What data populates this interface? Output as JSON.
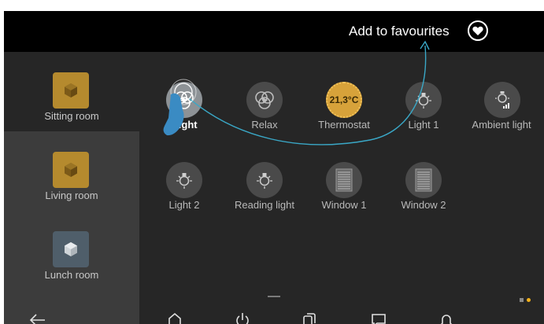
{
  "header": {
    "favourite_label": "Add to favourites",
    "favourite_icon": "heart-icon"
  },
  "sidebar": {
    "rooms": [
      {
        "label": "Sitting room",
        "color": "#b58a2e",
        "icon": "cube-icon"
      },
      {
        "label": "Living room",
        "color": "#b58a2e",
        "icon": "cube-icon",
        "selected": true
      },
      {
        "label": "Lunch room",
        "color": "#4f5e6a",
        "icon": "cube-icon"
      }
    ]
  },
  "tiles": [
    {
      "label": "Night",
      "icon": "scene-play-icon",
      "active": true
    },
    {
      "label": "Relax",
      "icon": "scene-play-icon"
    },
    {
      "label": "Thermostat",
      "icon": "thermostat-dial-icon",
      "value": "21,3°C"
    },
    {
      "label": "Light 1",
      "icon": "bulb-icon"
    },
    {
      "label": "Ambient light",
      "icon": "dimmer-bulb-icon"
    },
    {
      "label": "Light 2",
      "icon": "bulb-icon"
    },
    {
      "label": "Reading light",
      "icon": "bulb-icon"
    },
    {
      "label": "Window 1",
      "icon": "window-icon"
    },
    {
      "label": "Window 2",
      "icon": "window-icon"
    }
  ],
  "nav": {
    "back": "back-arrow-icon",
    "home": "home-icon",
    "power": "power-icon",
    "scenes": "copy-icon",
    "messages": "message-icon",
    "alarm": "bell-icon"
  },
  "colors": {
    "accent": "#f5b21b",
    "gesture_line": "#3aa8c7",
    "hand": "#3a8bc3"
  },
  "pager": {
    "pages": 2,
    "current": 2
  }
}
